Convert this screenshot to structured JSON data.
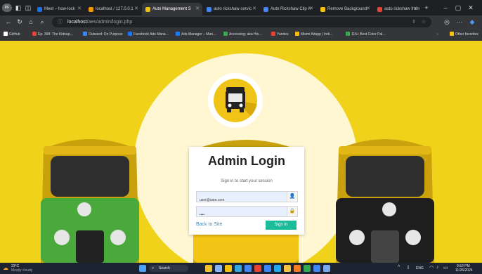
{
  "browser": {
    "tabs": [
      {
        "label": "Meet – how-lock",
        "favicon_color": "#1a73e8"
      },
      {
        "label": "localhost / 127.0.0.1",
        "favicon_color": "#f29900"
      },
      {
        "label": "Auto Management S",
        "favicon_color": "#f2c00f"
      },
      {
        "label": "auto rickshaw cervic",
        "favicon_color": "#4285f4"
      },
      {
        "label": "Auto Rickshaw Clip A",
        "favicon_color": "#4285f4"
      },
      {
        "label": "Remove Background",
        "favicon_color": "#f4c20d"
      },
      {
        "label": "auto rickshaw fram",
        "favicon_color": "#ea4335"
      }
    ],
    "active_tab_index": 2,
    "url": {
      "host": "localhost",
      "path": "/aes/admin/login.php"
    },
    "bookmarks": [
      {
        "label": "GitHub",
        "color": "#ffffff"
      },
      {
        "label": "Ep. 398: The Kidnap…",
        "color": "#ea4335"
      },
      {
        "label": "Outward: On Purpose",
        "color": "#4285f4"
      },
      {
        "label": "Facebook Ads Mana…",
        "color": "#1877f2"
      },
      {
        "label": "Ads Manager – Man…",
        "color": "#1877f2"
      },
      {
        "label": "Accessing: aka His…",
        "color": "#34a853"
      },
      {
        "label": "Yandex",
        "color": "#ea4335"
      },
      {
        "label": "Miami Adapp | Indi…",
        "color": "#fbbc04"
      },
      {
        "label": "115+ Best Color Pal…",
        "color": "#34a853"
      },
      {
        "label": "Other favorites",
        "color": "#f4c20d"
      }
    ]
  },
  "login": {
    "title": "Admin Login",
    "subtitle": "Sign in to start your session",
    "email_value": "user@aam.com",
    "password_value": "••••",
    "back_link": "Back to Site",
    "signin_label": "Sign In"
  },
  "taskbar": {
    "weather_temp": "23°C",
    "weather_desc": "Mostly cloudy",
    "search_label": "Search",
    "lang": "ENG",
    "time": "9:53 PM",
    "date": "11/26/2024"
  },
  "colors": {
    "brand_yellow": "#f1d21a",
    "signin_button": "#1bbc9b",
    "link": "#3c8dbc"
  }
}
